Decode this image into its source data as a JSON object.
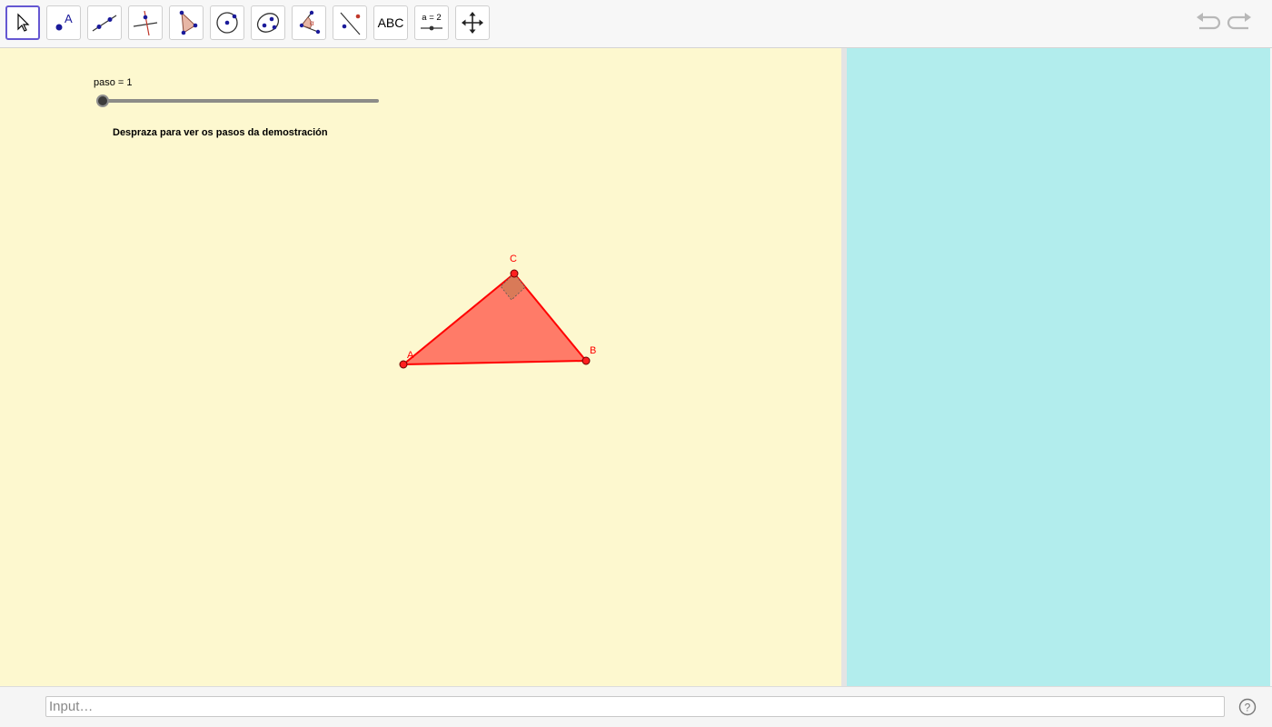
{
  "toolbar": {
    "tools": [
      {
        "name": "move-tool",
        "icon": "arrow-cursor-icon",
        "selected": true
      },
      {
        "name": "point-tool",
        "icon": "point-icon",
        "label": "A"
      },
      {
        "name": "line-tool",
        "icon": "line-through-two-points-icon"
      },
      {
        "name": "perpendicular-line-tool",
        "icon": "perpendicular-line-icon"
      },
      {
        "name": "polygon-tool",
        "icon": "polygon-icon"
      },
      {
        "name": "circle-tool",
        "icon": "circle-with-center-icon"
      },
      {
        "name": "ellipse-tool",
        "icon": "ellipse-icon"
      },
      {
        "name": "angle-tool",
        "icon": "angle-icon",
        "label": "α"
      },
      {
        "name": "reflect-tool",
        "icon": "reflect-about-line-icon"
      },
      {
        "name": "text-tool",
        "icon": "text-icon",
        "label": "ABC"
      },
      {
        "name": "slider-tool",
        "icon": "slider-icon",
        "label": "a = 2"
      },
      {
        "name": "move-graphics-view-tool",
        "icon": "move-graphics-view-icon"
      }
    ],
    "undo_icon": "undo-icon",
    "redo_icon": "redo-icon"
  },
  "graphics": {
    "background": "#fdf8cf",
    "slider": {
      "label": "paso = 1",
      "value": 1,
      "min": 1,
      "max": 10
    },
    "caption": "Despraza para ver os pasos da demostración",
    "triangle": {
      "fill": "#ff7b68",
      "stroke": "#ff0000",
      "points": [
        {
          "label": "A"
        },
        {
          "label": "B"
        },
        {
          "label": "C"
        }
      ],
      "right_angle_at": "C"
    }
  },
  "graphics2": {
    "background": "#b2eded"
  },
  "input_bar": {
    "placeholder": "Input…",
    "value": "",
    "help_icon": "help-icon"
  }
}
